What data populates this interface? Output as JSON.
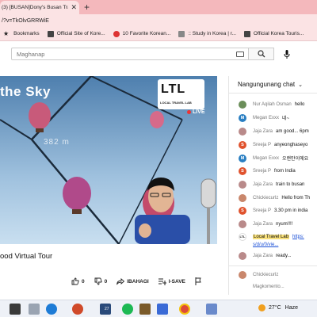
{
  "browser": {
    "tab_title": "(3) [BUSAN]Dony's Busan Travel Tips",
    "url": "/?v=TkOlvGRRWiE",
    "bookmarks": [
      {
        "label": "Bookmarks",
        "icon": "star-icon"
      },
      {
        "label": "Official Site of Kore...",
        "icon": "page-icon"
      },
      {
        "label": "10 Favorite Korean...",
        "icon": "page-icon"
      },
      {
        "label": ":: Study in Korea | r...",
        "icon": "page-icon"
      },
      {
        "label": "Official Korea Touris...",
        "icon": "page-icon"
      }
    ]
  },
  "search": {
    "placeholder": "Maghanap"
  },
  "video": {
    "overlay_text": "the Sky",
    "altitude_text": "382 m",
    "logo_mark": "LTL",
    "logo_name": "LOCAL TRAVEL LAB",
    "live_label": "LIVE",
    "title": "ood Virtual Tour",
    "actions": {
      "like_count": "0",
      "dislike_count": "0",
      "share_label": "IBAHAGI",
      "save_label": "I-SAVE"
    }
  },
  "chat": {
    "header": "Nangungunang chat",
    "messages": [
      {
        "author": "Nur Aqilah Osman",
        "text": "hello",
        "avatar_color": "#6b8e5a",
        "initial": ""
      },
      {
        "author": "Megan Exxx",
        "text": "네~",
        "avatar_color": "#2a7fc2",
        "initial": "M"
      },
      {
        "author": "Jaja Zara",
        "text": "am good... 6pm",
        "avatar_color": "#b98a8a",
        "initial": ""
      },
      {
        "author": "Sreeja P",
        "text": "anyeonghaseyo",
        "avatar_color": "#e0532e",
        "initial": "S"
      },
      {
        "author": "Megan Exxx",
        "text": "오랜만이에요",
        "avatar_color": "#2a7fc2",
        "initial": "M"
      },
      {
        "author": "Sreeja P",
        "text": "from India",
        "avatar_color": "#e0532e",
        "initial": "S"
      },
      {
        "author": "Jaja Zara",
        "text": "train to busan",
        "avatar_color": "#b98a8a",
        "initial": ""
      },
      {
        "author": "Chickiecurlz",
        "text": "Hello from Th",
        "avatar_color": "#c9876c",
        "initial": ""
      },
      {
        "author": "Sreeja P",
        "text": "3.30 pm in india",
        "avatar_color": "#e0532e",
        "initial": "S"
      },
      {
        "author": "Jaja Zara",
        "text": "nyum!!!!",
        "avatar_color": "#b98a8a",
        "initial": ""
      }
    ],
    "pinned_author": "Local Travel Lab",
    "pinned_link_1": "https:",
    "pinned_link_2": "s/d/u/0/vie...",
    "last_message": {
      "author": "Jaja Zara",
      "text": "ready..."
    },
    "input_author": "Chickiecurlz",
    "input_placeholder": "Magkomento..."
  },
  "taskbar": {
    "badge": "27",
    "temperature": "27°C",
    "condition": "Haze"
  }
}
